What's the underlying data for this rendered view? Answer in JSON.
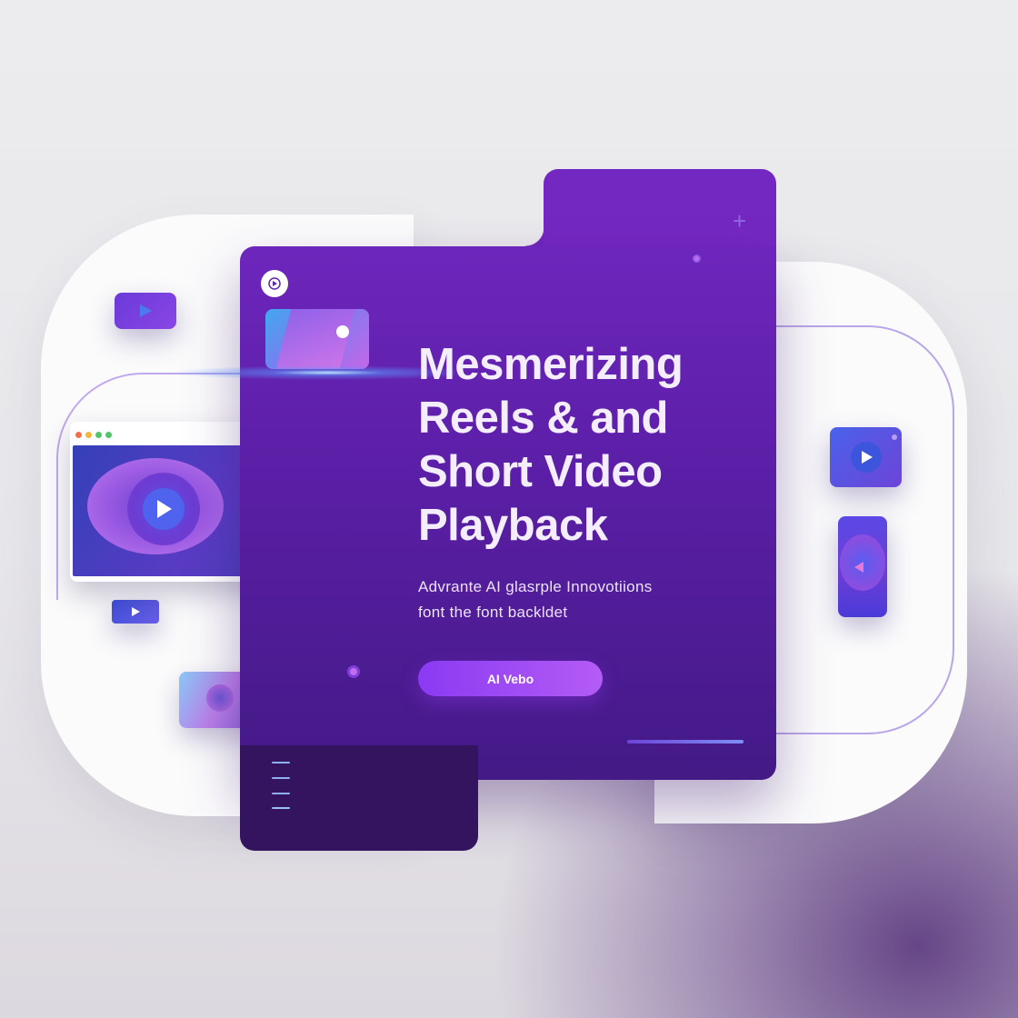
{
  "hero": {
    "title": "Mesmerizing\nReels & and\nShort Video\nPlayback",
    "subtitle": "Advrante AI glasrple Innovotiions\nfont the font backldet",
    "cta_label": "AI Vebo"
  },
  "colors": {
    "panel_purple": "#6d26bc",
    "panel_dark": "#34145f",
    "accent_pink": "#e67ae8",
    "cta_start": "#8a3af2",
    "cta_end": "#b45cf6",
    "icon_blue": "#4a5ee8"
  },
  "icons": {
    "play": "play-icon",
    "plus": "plus-icon",
    "more": "more-dots-icon",
    "window_dots": "window-control-dots"
  }
}
